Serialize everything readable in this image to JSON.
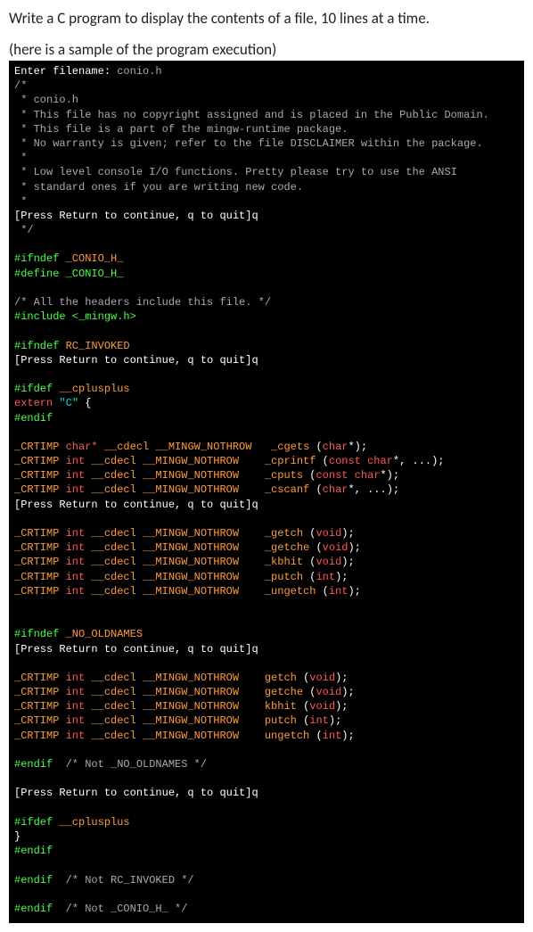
{
  "instruction": "Write a C program to display the contents of a file, 10 lines at a time.",
  "sample_label": "(here is a sample of the program execution)",
  "terminal": {
    "prompt_line": [
      {
        "t": "Enter filename: ",
        "cls": "white"
      },
      {
        "t": "conio.h",
        "cls": "gray"
      }
    ],
    "lines": [
      [
        {
          "t": "/*",
          "cls": "gray"
        }
      ],
      [
        {
          "t": " * conio.h",
          "cls": "gray"
        }
      ],
      [
        {
          "t": " * This file has no copyright assigned and is placed in the Public Domain.",
          "cls": "gray"
        }
      ],
      [
        {
          "t": " * This file is a part of the mingw-runtime package.",
          "cls": "gray"
        }
      ],
      [
        {
          "t": " * No warranty is given; refer to the file DISCLAIMER within the package.",
          "cls": "gray"
        }
      ],
      [
        {
          "t": " *",
          "cls": "gray"
        }
      ],
      [
        {
          "t": " * Low level console I/O functions. Pretty please try to use the ANSI",
          "cls": "gray"
        }
      ],
      [
        {
          "t": " * standard ones if you are writing new code.",
          "cls": "gray"
        }
      ],
      [
        {
          "t": " *",
          "cls": "gray"
        }
      ],
      [
        {
          "t": "[Press Return to continue, q to quit]q",
          "cls": "white"
        }
      ],
      [
        {
          "t": " */",
          "cls": "gray"
        }
      ],
      [],
      [
        {
          "t": "#ifndef ",
          "cls": "green"
        },
        {
          "t": "_CONIO_H_",
          "cls": "orange"
        }
      ],
      [
        {
          "t": "#define _CONIO_H_",
          "cls": "green"
        }
      ],
      [],
      [
        {
          "t": "/* All the headers include this file. */",
          "cls": "gray"
        }
      ],
      [
        {
          "t": "#include <_mingw.h>",
          "cls": "green"
        }
      ],
      [],
      [
        {
          "t": "#ifndef ",
          "cls": "green"
        },
        {
          "t": "RC_INVOKED",
          "cls": "orange"
        }
      ],
      [
        {
          "t": "[Press Return to continue, q to quit]q",
          "cls": "white"
        }
      ],
      [],
      [
        {
          "t": "#ifdef ",
          "cls": "green"
        },
        {
          "t": "__cplusplus",
          "cls": "orange"
        }
      ],
      [
        {
          "t": "extern ",
          "cls": "red"
        },
        {
          "t": "\"C\" ",
          "cls": "cyan"
        },
        {
          "t": "{",
          "cls": "white"
        }
      ],
      [
        {
          "t": "#endif",
          "cls": "green"
        }
      ],
      [],
      [
        {
          "t": "_CRTIMP ",
          "cls": "orange"
        },
        {
          "t": "char* ",
          "cls": "red"
        },
        {
          "t": "__cdecl __MINGW_NOTHROW   _cgets ",
          "cls": "orange"
        },
        {
          "t": "(",
          "cls": "white"
        },
        {
          "t": "char",
          "cls": "red"
        },
        {
          "t": "*);",
          "cls": "white"
        }
      ],
      [
        {
          "t": "_CRTIMP ",
          "cls": "orange"
        },
        {
          "t": "int ",
          "cls": "red"
        },
        {
          "t": "__cdecl __MINGW_NOTHROW    _cprintf ",
          "cls": "orange"
        },
        {
          "t": "(",
          "cls": "white"
        },
        {
          "t": "const char",
          "cls": "red"
        },
        {
          "t": "*, ...);",
          "cls": "white"
        }
      ],
      [
        {
          "t": "_CRTIMP ",
          "cls": "orange"
        },
        {
          "t": "int ",
          "cls": "red"
        },
        {
          "t": "__cdecl __MINGW_NOTHROW    _cputs ",
          "cls": "orange"
        },
        {
          "t": "(",
          "cls": "white"
        },
        {
          "t": "const char",
          "cls": "red"
        },
        {
          "t": "*);",
          "cls": "white"
        }
      ],
      [
        {
          "t": "_CRTIMP ",
          "cls": "orange"
        },
        {
          "t": "int ",
          "cls": "red"
        },
        {
          "t": "__cdecl __MINGW_NOTHROW    _cscanf ",
          "cls": "orange"
        },
        {
          "t": "(",
          "cls": "white"
        },
        {
          "t": "char",
          "cls": "red"
        },
        {
          "t": "*, ...);",
          "cls": "white"
        }
      ],
      [
        {
          "t": "[Press Return to continue, q to quit]q",
          "cls": "white"
        }
      ],
      [],
      [
        {
          "t": "_CRTIMP ",
          "cls": "orange"
        },
        {
          "t": "int ",
          "cls": "red"
        },
        {
          "t": "__cdecl __MINGW_NOTHROW    _getch ",
          "cls": "orange"
        },
        {
          "t": "(",
          "cls": "white"
        },
        {
          "t": "void",
          "cls": "red"
        },
        {
          "t": ");",
          "cls": "white"
        }
      ],
      [
        {
          "t": "_CRTIMP ",
          "cls": "orange"
        },
        {
          "t": "int ",
          "cls": "red"
        },
        {
          "t": "__cdecl __MINGW_NOTHROW    _getche ",
          "cls": "orange"
        },
        {
          "t": "(",
          "cls": "white"
        },
        {
          "t": "void",
          "cls": "red"
        },
        {
          "t": ");",
          "cls": "white"
        }
      ],
      [
        {
          "t": "_CRTIMP ",
          "cls": "orange"
        },
        {
          "t": "int ",
          "cls": "red"
        },
        {
          "t": "__cdecl __MINGW_NOTHROW    _kbhit ",
          "cls": "orange"
        },
        {
          "t": "(",
          "cls": "white"
        },
        {
          "t": "void",
          "cls": "red"
        },
        {
          "t": ");",
          "cls": "white"
        }
      ],
      [
        {
          "t": "_CRTIMP ",
          "cls": "orange"
        },
        {
          "t": "int ",
          "cls": "red"
        },
        {
          "t": "__cdecl __MINGW_NOTHROW    _putch ",
          "cls": "orange"
        },
        {
          "t": "(",
          "cls": "white"
        },
        {
          "t": "int",
          "cls": "red"
        },
        {
          "t": ");",
          "cls": "white"
        }
      ],
      [
        {
          "t": "_CRTIMP ",
          "cls": "orange"
        },
        {
          "t": "int ",
          "cls": "red"
        },
        {
          "t": "__cdecl __MINGW_NOTHROW    _ungetch ",
          "cls": "orange"
        },
        {
          "t": "(",
          "cls": "white"
        },
        {
          "t": "int",
          "cls": "red"
        },
        {
          "t": ");",
          "cls": "white"
        }
      ],
      [],
      [],
      [
        {
          "t": "#ifndef ",
          "cls": "green"
        },
        {
          "t": "_NO_OLDNAMES",
          "cls": "orange"
        }
      ],
      [
        {
          "t": "[Press Return to continue, q to quit]q",
          "cls": "white"
        }
      ],
      [],
      [
        {
          "t": "_CRTIMP ",
          "cls": "orange"
        },
        {
          "t": "int ",
          "cls": "red"
        },
        {
          "t": "__cdecl __MINGW_NOTHROW    getch ",
          "cls": "orange"
        },
        {
          "t": "(",
          "cls": "white"
        },
        {
          "t": "void",
          "cls": "red"
        },
        {
          "t": ");",
          "cls": "white"
        }
      ],
      [
        {
          "t": "_CRTIMP ",
          "cls": "orange"
        },
        {
          "t": "int ",
          "cls": "red"
        },
        {
          "t": "__cdecl __MINGW_NOTHROW    getche ",
          "cls": "orange"
        },
        {
          "t": "(",
          "cls": "white"
        },
        {
          "t": "void",
          "cls": "red"
        },
        {
          "t": ");",
          "cls": "white"
        }
      ],
      [
        {
          "t": "_CRTIMP ",
          "cls": "orange"
        },
        {
          "t": "int ",
          "cls": "red"
        },
        {
          "t": "__cdecl __MINGW_NOTHROW    kbhit ",
          "cls": "orange"
        },
        {
          "t": "(",
          "cls": "white"
        },
        {
          "t": "void",
          "cls": "red"
        },
        {
          "t": ");",
          "cls": "white"
        }
      ],
      [
        {
          "t": "_CRTIMP ",
          "cls": "orange"
        },
        {
          "t": "int ",
          "cls": "red"
        },
        {
          "t": "__cdecl __MINGW_NOTHROW    putch ",
          "cls": "orange"
        },
        {
          "t": "(",
          "cls": "white"
        },
        {
          "t": "int",
          "cls": "red"
        },
        {
          "t": ");",
          "cls": "white"
        }
      ],
      [
        {
          "t": "_CRTIMP ",
          "cls": "orange"
        },
        {
          "t": "int ",
          "cls": "red"
        },
        {
          "t": "__cdecl __MINGW_NOTHROW    ungetch ",
          "cls": "orange"
        },
        {
          "t": "(",
          "cls": "white"
        },
        {
          "t": "int",
          "cls": "red"
        },
        {
          "t": ");",
          "cls": "white"
        }
      ],
      [],
      [
        {
          "t": "#endif  ",
          "cls": "green"
        },
        {
          "t": "/* Not _NO_OLDNAMES */",
          "cls": "gray"
        }
      ],
      [],
      [
        {
          "t": "[Press Return to continue, q to quit]q",
          "cls": "white"
        }
      ],
      [],
      [
        {
          "t": "#ifdef ",
          "cls": "green"
        },
        {
          "t": "__cplusplus",
          "cls": "orange"
        }
      ],
      [
        {
          "t": "}",
          "cls": "white"
        }
      ],
      [
        {
          "t": "#endif",
          "cls": "green"
        }
      ],
      [],
      [
        {
          "t": "#endif  ",
          "cls": "green"
        },
        {
          "t": "/* Not RC_INVOKED */",
          "cls": "gray"
        }
      ],
      [],
      [
        {
          "t": "#endif  ",
          "cls": "green"
        },
        {
          "t": "/* Not _CONIO_H_ */",
          "cls": "gray"
        }
      ]
    ]
  }
}
